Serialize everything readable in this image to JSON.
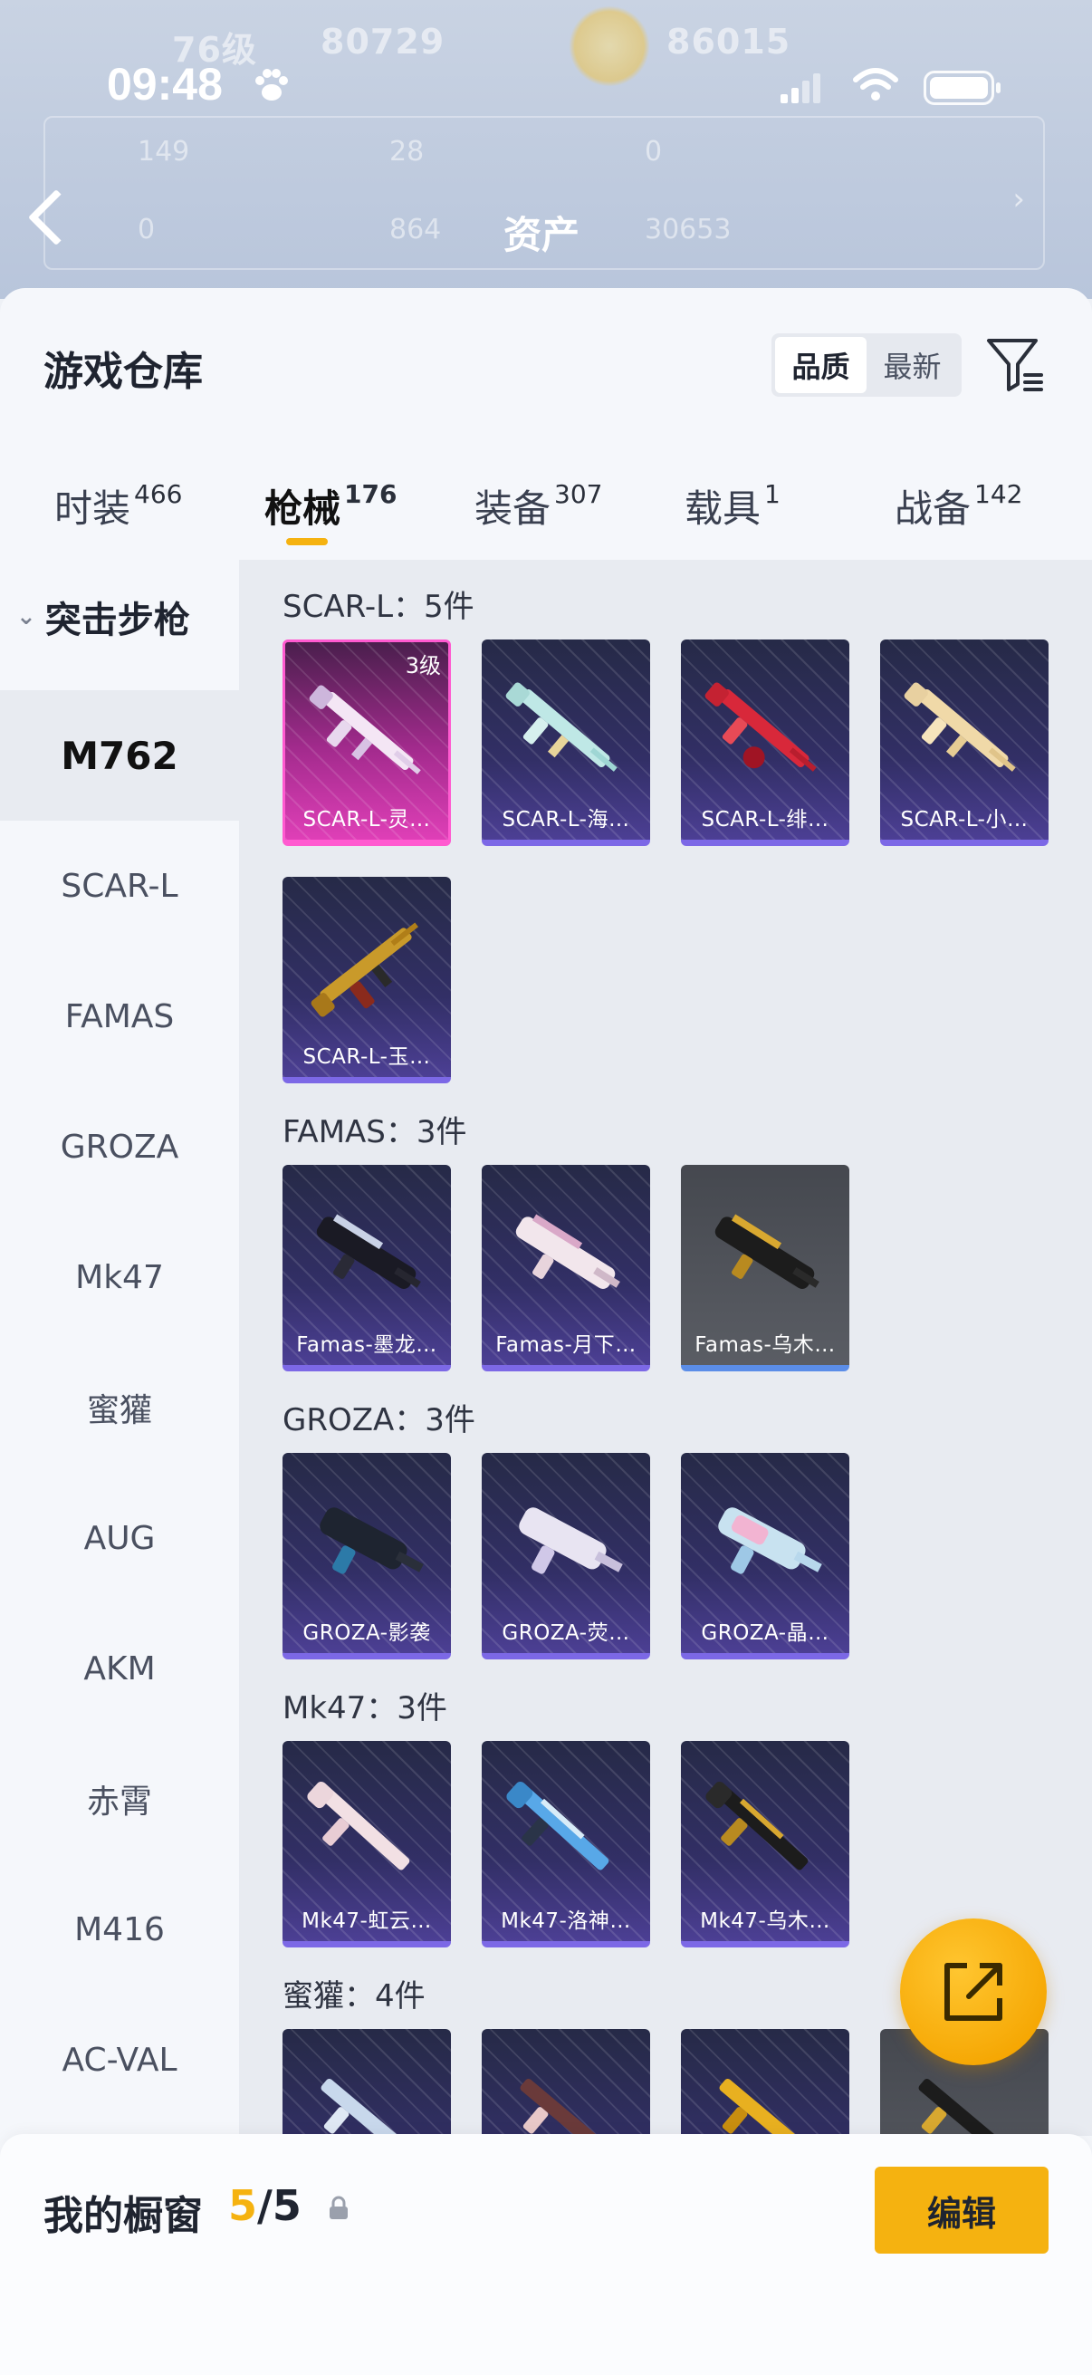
{
  "status_bar": {
    "time": "09:48"
  },
  "background": {
    "title": "资产",
    "level_text": "76级",
    "stats": [
      "80729",
      "86015",
      "149",
      "28",
      "0",
      "0",
      "864",
      "30653"
    ]
  },
  "sheet": {
    "title": "游戏仓库",
    "sort": {
      "quality": "品质",
      "latest": "最新",
      "active": "quality"
    },
    "tabs": [
      {
        "label": "时装",
        "count": "466"
      },
      {
        "label": "枪械",
        "count": "176"
      },
      {
        "label": "装备",
        "count": "307"
      },
      {
        "label": "载具",
        "count": "1"
      },
      {
        "label": "战备",
        "count": "142"
      }
    ],
    "category": {
      "header": "突击步枪",
      "items": [
        "M762",
        "SCAR-L",
        "FAMAS",
        "GROZA",
        "Mk47",
        "蜜獾",
        "AUG",
        "AKM",
        "赤霄",
        "M416",
        "AC-VAL"
      ]
    },
    "groups": [
      {
        "title": "SCAR-L：5件",
        "items": [
          {
            "name": "SCAR-L-灵…",
            "badge": "3级",
            "style": "pink"
          },
          {
            "name": "SCAR-L-海…",
            "style": "purple"
          },
          {
            "name": "SCAR-L-绯…",
            "style": "purple"
          },
          {
            "name": "SCAR-L-小…",
            "style": "purple"
          },
          {
            "name": "SCAR-L-玉…",
            "style": "purple"
          }
        ]
      },
      {
        "title": "FAMAS：3件",
        "items": [
          {
            "name": "Famas-墨龙…",
            "style": "purple"
          },
          {
            "name": "Famas-月下…",
            "style": "purple"
          },
          {
            "name": "Famas-乌木…",
            "style": "gray"
          }
        ]
      },
      {
        "title": "GROZA：3件",
        "items": [
          {
            "name": "GROZA-影袭",
            "style": "purple"
          },
          {
            "name": "GROZA-荧…",
            "style": "purple"
          },
          {
            "name": "GROZA-晶…",
            "style": "purple"
          }
        ]
      },
      {
        "title": "Mk47：3件",
        "items": [
          {
            "name": "Mk47-虹云…",
            "style": "purple"
          },
          {
            "name": "Mk47-洛神…",
            "style": "purple"
          },
          {
            "name": "Mk47-乌木…",
            "style": "purple"
          }
        ]
      },
      {
        "title": "蜜獾：4件",
        "items": [
          {
            "name": "",
            "style": "purple"
          },
          {
            "name": "",
            "style": "purple"
          },
          {
            "name": "",
            "style": "purple"
          },
          {
            "name": "",
            "style": "gray"
          }
        ]
      }
    ]
  },
  "bottom_bar": {
    "label": "我的橱窗",
    "current": "5",
    "separator": "/",
    "total": "5",
    "edit_label": "编辑"
  },
  "icons": {
    "back": "back-arrow-icon",
    "filter": "filter-icon",
    "share": "share-external-icon",
    "lock": "lock-icon"
  },
  "colors": {
    "accent": "#f5b210",
    "card_purple": "#322f66",
    "card_pink": "#df3fb7",
    "card_gray": "#5a5d64"
  }
}
